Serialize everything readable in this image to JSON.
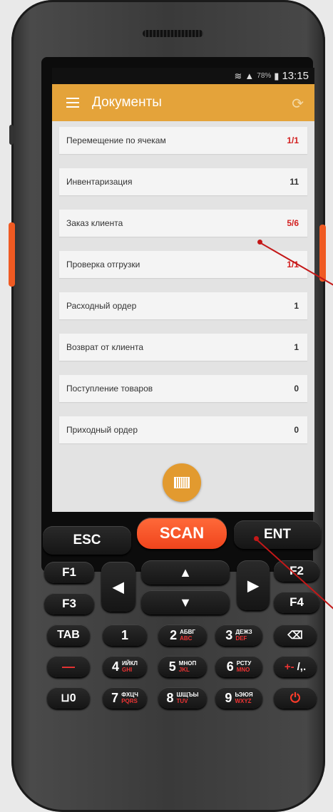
{
  "status": {
    "battery": "78%",
    "time": "13:15"
  },
  "appbar": {
    "title": "Документы"
  },
  "documents": [
    {
      "label": "Перемещение по ячекам",
      "count": "1/1"
    },
    {
      "label": "Инвентаризация",
      "count": "11"
    },
    {
      "label": "Заказ клиента",
      "count": "5/6"
    },
    {
      "label": "Проверка отгрузки",
      "count": "1/1"
    },
    {
      "label": "Расходный ордер",
      "count": "1"
    },
    {
      "label": "Возврат от клиента",
      "count": "1"
    },
    {
      "label": "Поступление товаров",
      "count": "0"
    },
    {
      "label": "Приходный ордер",
      "count": "0"
    }
  ],
  "keys": {
    "esc": "ESC",
    "scan": "SCAN",
    "ent": "ENT",
    "f1": "F1",
    "f2": "F2",
    "f3": "F3",
    "f4": "F4",
    "tab": "TAB",
    "k1": "1",
    "k2": "2",
    "k2a": "АБВГ",
    "k2b": "ABC",
    "k3": "3",
    "k3a": "ДЕЖЗ",
    "k3b": "DEF",
    "k4": "4",
    "k4a": "ИЙКЛ",
    "k4b": "GHI",
    "k5": "5",
    "k5a": "МНОП",
    "k5b": "JKL",
    "k6": "6",
    "k6a": "РСТУ",
    "k6b": "MNO",
    "k7": "7",
    "k7a": "ФХЦЧ",
    "k7b": "PQRS",
    "k8": "8",
    "k8a": "ШЩЪЫ",
    "k8b": "TUV",
    "k9": "9",
    "k9a": "ЬЭЮЯ",
    "k9b": "WXYZ",
    "k0": "⊔0",
    "minus": "—",
    "plusminus": "+-",
    "punct": "/,."
  },
  "colors": {
    "accent": "#e4a33a",
    "scan": "#f0441c",
    "red_count": "#d32020"
  }
}
